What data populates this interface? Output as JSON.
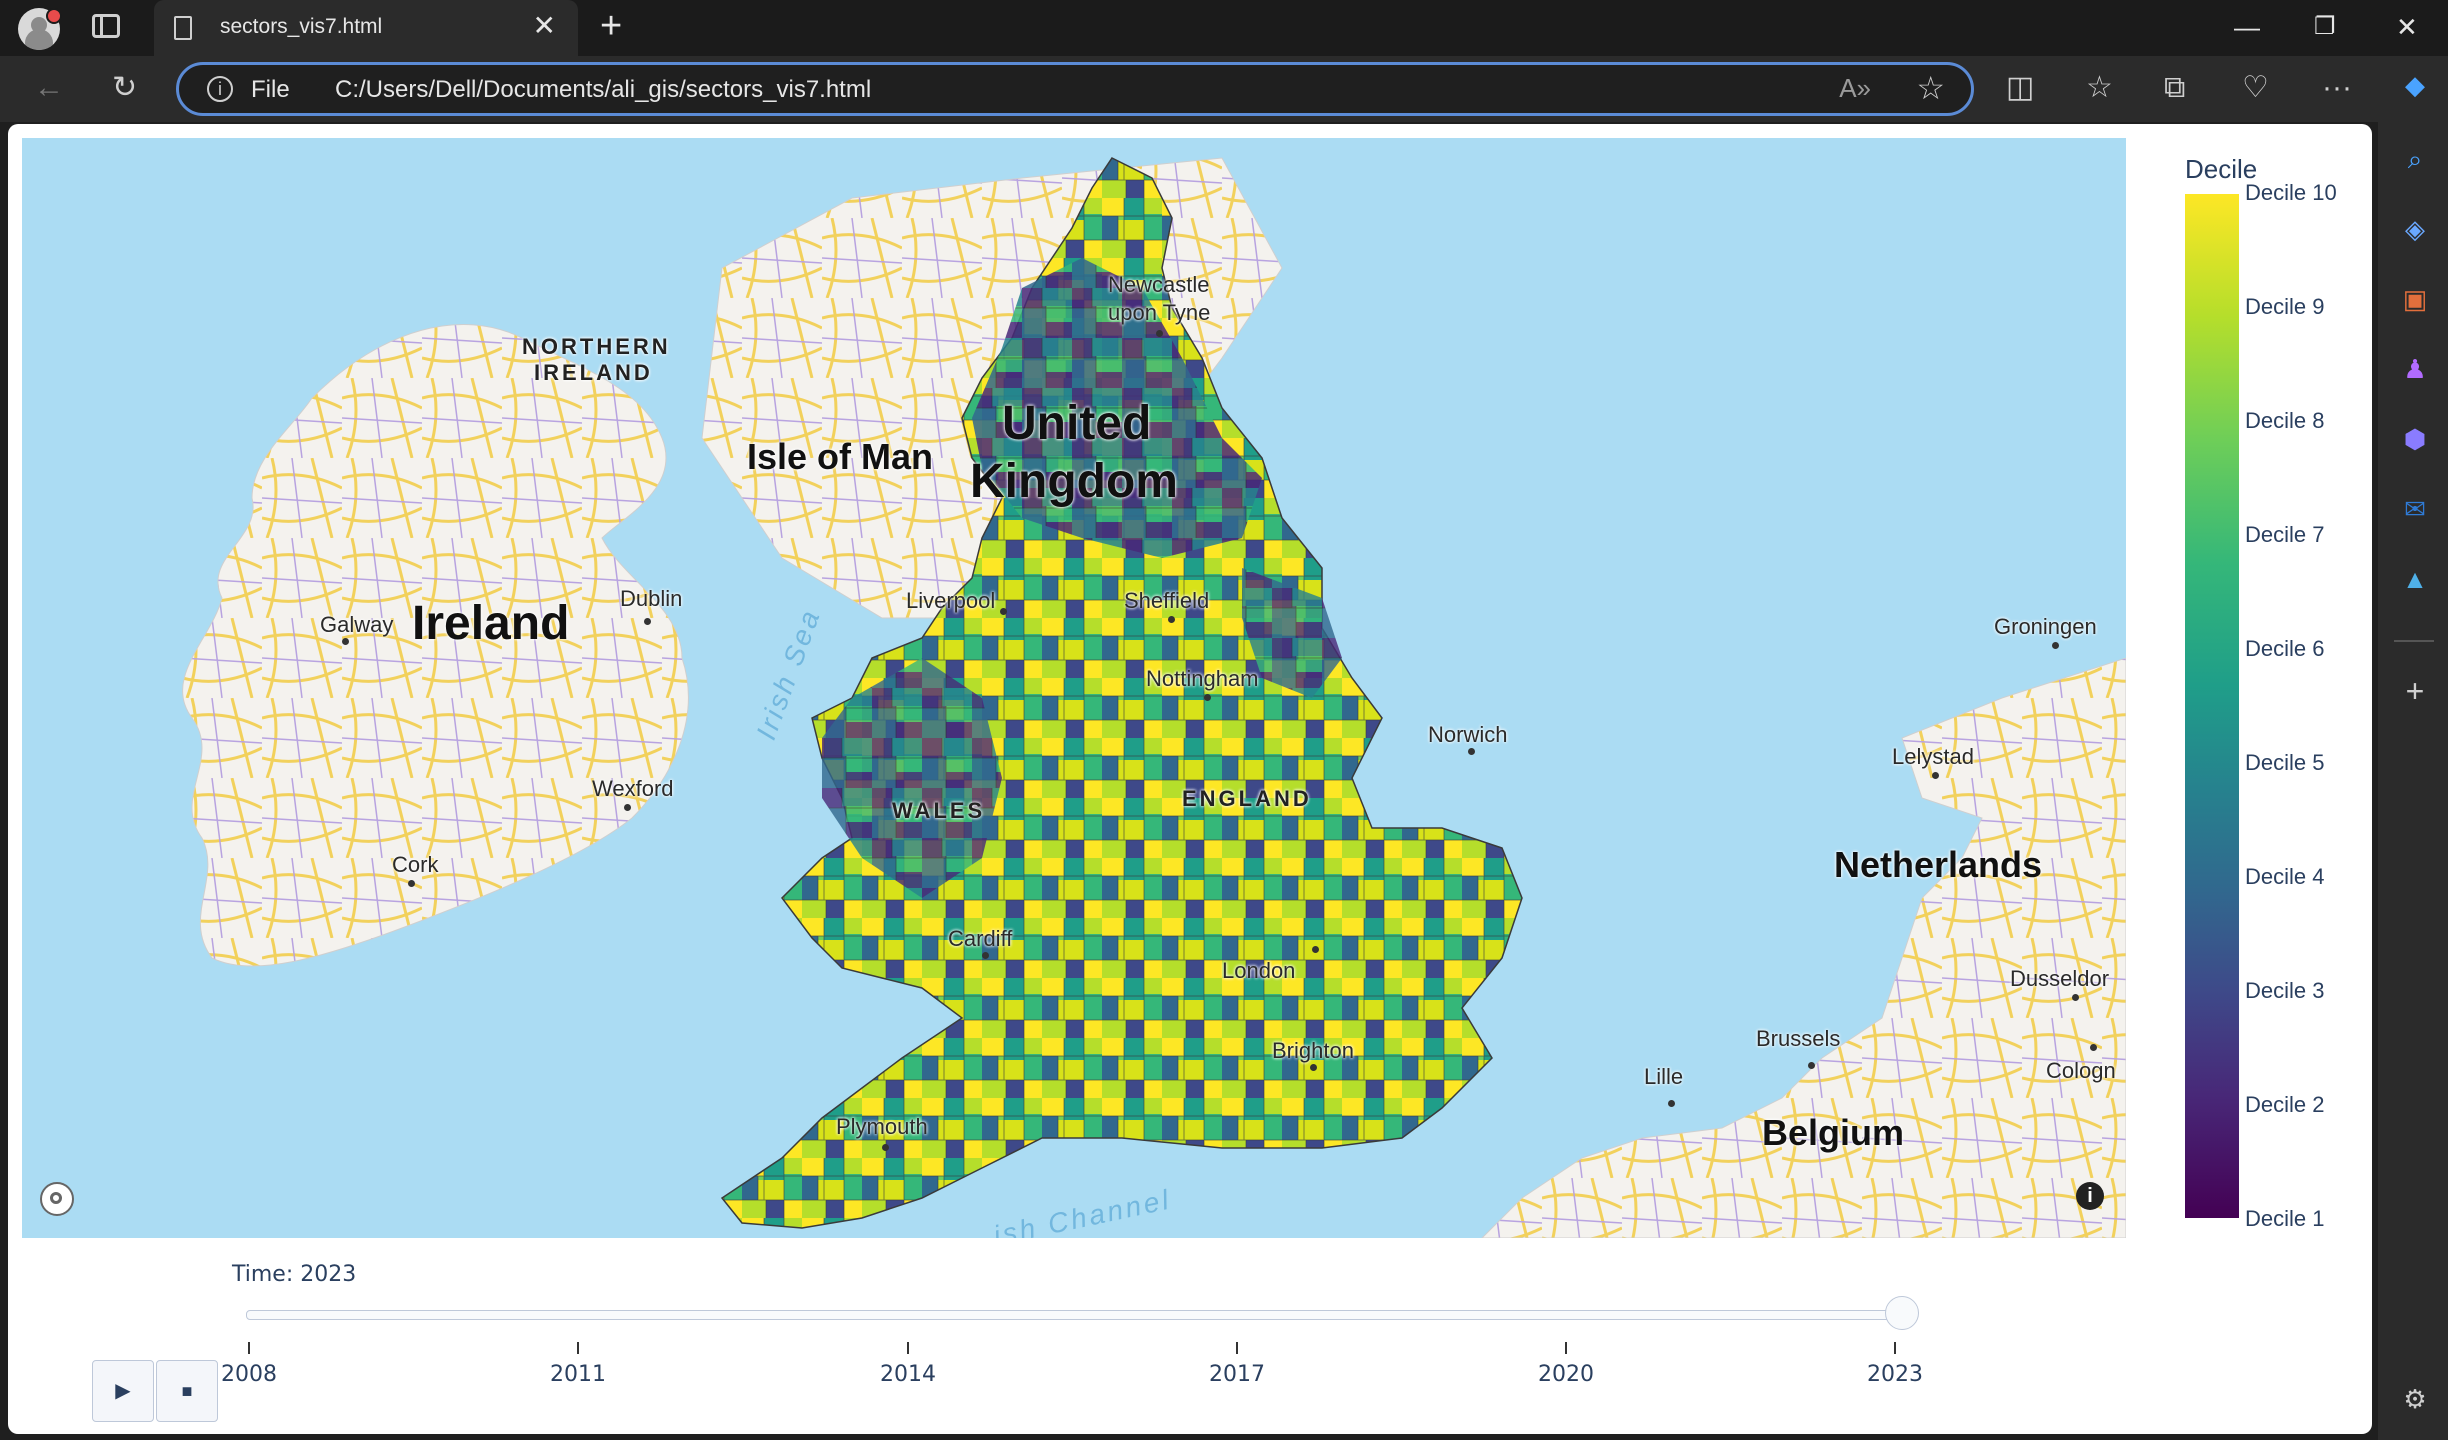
{
  "browser": {
    "tab_title": "sectors_vis7.html",
    "address_scheme": "File",
    "url": "C:/Users/Dell/Documents/ali_gis/sectors_vis7.html"
  },
  "map": {
    "labels": {
      "northern_ireland_1": "NORTHERN",
      "northern_ireland_2": "IRELAND",
      "isle_of_man": "Isle of Man",
      "united_kingdom_1": "United",
      "united_kingdom_2": "Kingdom",
      "newcastle_1": "Newcastle",
      "newcastle_2": "upon Tyne",
      "ireland": "Ireland",
      "dublin": "Dublin",
      "galway": "Galway",
      "wexford": "Wexford",
      "cork": "Cork",
      "irish_sea": "Irish Sea",
      "liverpool": "Liverpool",
      "sheffield": "Sheffield",
      "nottingham": "Nottingham",
      "norwich": "Norwich",
      "wales": "WALES",
      "england": "ENGLAND",
      "cardiff": "Cardiff",
      "london": "London",
      "brighton": "Brighton",
      "plymouth": "Plymouth",
      "english_channel": "ish Channel",
      "groningen": "Groningen",
      "lelystad": "Lelystad",
      "netherlands": "Netherlands",
      "dusseldorf": "Dusseldor",
      "brussels": "Brussels",
      "cologne": "Cologn",
      "lille": "Lille",
      "belgium": "Belgium"
    }
  },
  "colorbar": {
    "title": "Decile",
    "ticks": [
      "Decile 10",
      "Decile 9",
      "Decile 8",
      "Decile 7",
      "Decile 6",
      "Decile 5",
      "Decile 4",
      "Decile 3",
      "Decile 2",
      "Decile 1"
    ]
  },
  "slider": {
    "current_label": "Time: 2023",
    "current_value": 2023,
    "ticks": [
      "2008",
      "2011",
      "2014",
      "2017",
      "2020",
      "2023"
    ]
  },
  "controls": {
    "play_glyph": "▶",
    "stop_glyph": "■"
  },
  "colors": {
    "viridis_low": "#440154",
    "viridis_high": "#fde725",
    "sea": "#abdcf3",
    "land": "#f4f2ee"
  }
}
